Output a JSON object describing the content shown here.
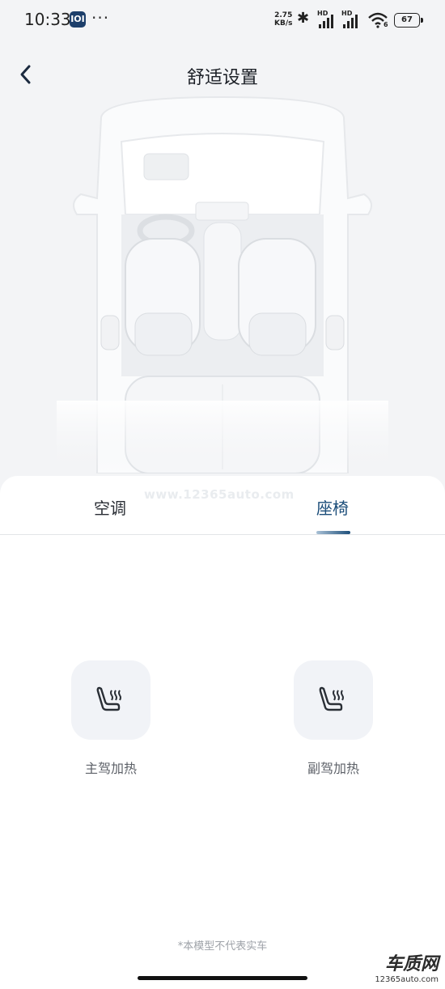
{
  "status_bar": {
    "time": "10:33",
    "app_icon": "IOI",
    "more": "···",
    "net_speed_value": "2.75",
    "net_speed_unit": "KB/s",
    "bluetooth": "✱",
    "signal1_label": "HD",
    "signal2_label": "HD",
    "wifi_sub": "6",
    "battery": "67"
  },
  "header": {
    "title": "舒适设置"
  },
  "tabs": [
    {
      "label": "空调",
      "selected": false
    },
    {
      "label": "座椅",
      "selected": true
    }
  ],
  "watermark": "www.12365auto.com",
  "seat_heating": {
    "driver_label": "主驾加热",
    "passenger_label": "副驾加热"
  },
  "disclaimer": "*本模型不代表实车",
  "corner_logo": {
    "text": "车质网",
    "url": "12365auto.com"
  },
  "colors": {
    "accent": "#1c4e7a",
    "page_bg": "#f3f4f6",
    "button_bg": "#f1f3f7"
  }
}
